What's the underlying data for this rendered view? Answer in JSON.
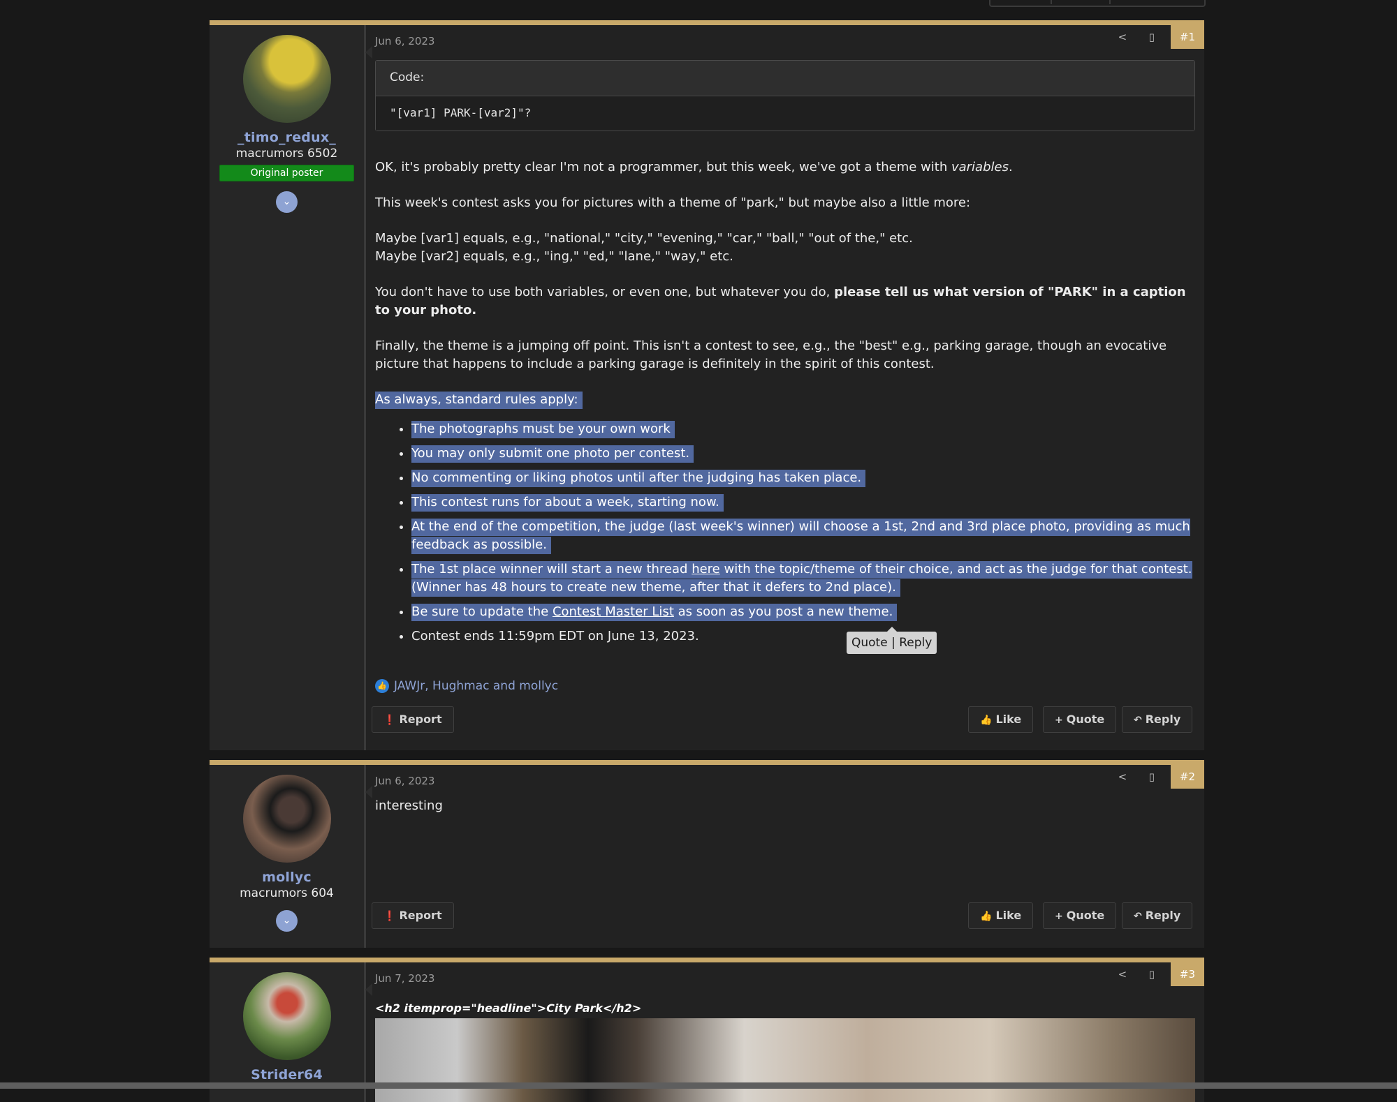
{
  "posts": [
    {
      "number": "#1",
      "date": "Jun 6, 2023",
      "user": {
        "name": "_timo_redux_",
        "title": "macrumors 6502",
        "badge": "Original poster"
      },
      "code": {
        "header": "Code:",
        "content": "\"[var1] PARK-[var2]\"?"
      },
      "paragraphs": {
        "p1_a": "OK, it's probably pretty clear I'm not a programmer, but this week, we've got a theme with ",
        "p1_em": "variables",
        "p1_end": ".",
        "p2": "This week's contest asks you for pictures with a theme of \"park,\" but maybe also a little more:",
        "p3_line1": "Maybe [var1] equals, e.g., \"national,\" \"city,\" \"evening,\" \"car,\" \"ball,\" \"out of the,\" etc.",
        "p3_line2": "Maybe [var2] equals, e.g., \"ing,\" \"ed,\" \"lane,\" \"way,\" etc.",
        "p4_a": "You don't have to use both variables, or even one, but whatever you do, ",
        "p4_bold": "please tell us what version of \"PARK\" in a caption to your photo.",
        "p5": "Finally, the theme is a jumping off point. This isn't a contest to see, e.g., the \"best\" e.g., parking garage, though an evocative picture that happens to include a parking garage is definitely in the spirit of this contest.",
        "rules_intro": "As always, standard rules apply:"
      },
      "rules": {
        "r1": "The photographs must be your own work",
        "r2": "You may only submit one photo per contest.",
        "r3": "No commenting or liking photos until after the judging has taken place.",
        "r4": "This contest runs for about a week, starting now.",
        "r5": "At the end of the competition, the judge (last week's winner) will choose a 1st, 2nd and 3rd place photo, providing as much feedback as possible.",
        "r6_a": "The 1st place winner will start a new thread ",
        "r6_link": "here",
        "r6_b": " with the topic/theme of their choice, and act as the judge for that contest. (Winner has 48 hours to create new theme, after that it defers to 2nd place).",
        "r7_a": "Be sure to update the ",
        "r7_link": "Contest Master List",
        "r7_b": " as soon as you post a new theme.",
        "r8": "Contest ends 11:59pm EDT on June 13, 2023."
      },
      "tooltip": {
        "quote": "Quote",
        "sep": "|",
        "reply": "Reply"
      },
      "reactions": "JAWJr, Hughmac and mollyc"
    },
    {
      "number": "#2",
      "date": "Jun 6, 2023",
      "user": {
        "name": "mollyc",
        "title": "macrumors 604"
      },
      "text": "interesting"
    },
    {
      "number": "#3",
      "date": "Jun 7, 2023",
      "user": {
        "name": "Strider64"
      },
      "headline": "<h2 itemprop=\"headline\">City Park</h2>"
    }
  ],
  "buttons": {
    "report": "Report",
    "like": "Like",
    "quote": "Quote",
    "reply": "Reply"
  },
  "icons": {
    "share": "share-icon",
    "bookmark": "bookmark-icon",
    "expand": "chevron-down-icon",
    "report": "alert-circle-icon",
    "like": "thumbs-up-icon",
    "quote": "plus-icon",
    "reply": "reply-arrow-icon"
  },
  "colors": {
    "accent": "#c9a96a",
    "link": "#8fa4d6",
    "selection": "#51689f",
    "op_badge": "#138a1a",
    "background": "#181818"
  }
}
